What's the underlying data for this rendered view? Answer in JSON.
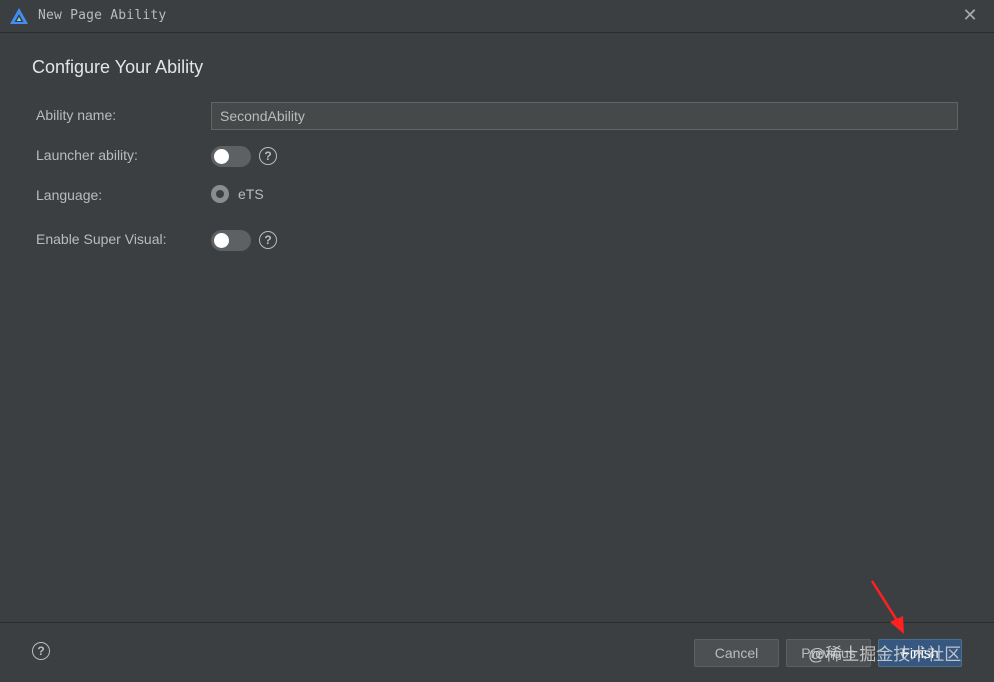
{
  "window": {
    "title": "New Page Ability"
  },
  "page": {
    "heading": "Configure Your Ability"
  },
  "form": {
    "ability_name_label": "Ability name:",
    "ability_name_value": "SecondAbility",
    "launcher_label": "Launcher ability:",
    "launcher_enabled": false,
    "language_label": "Language:",
    "language_option": "eTS",
    "super_visual_label": "Enable Super Visual:",
    "super_visual_enabled": false,
    "help_glyph": "?"
  },
  "footer": {
    "help_glyph": "?",
    "cancel_label": "Cancel",
    "previous_label": "Previous",
    "finish_label": "Finish"
  },
  "watermark": {
    "text": "@稀土掘金技术社区"
  },
  "icons": {
    "app_logo": "harmony-logo-icon",
    "close": "close-icon",
    "help": "help-icon",
    "annotation": "red-arrow-icon"
  },
  "colors": {
    "background": "#3c3f41",
    "primary_button": "#365880",
    "logo": "#3f8ff0",
    "annotation": "#ff2020"
  }
}
